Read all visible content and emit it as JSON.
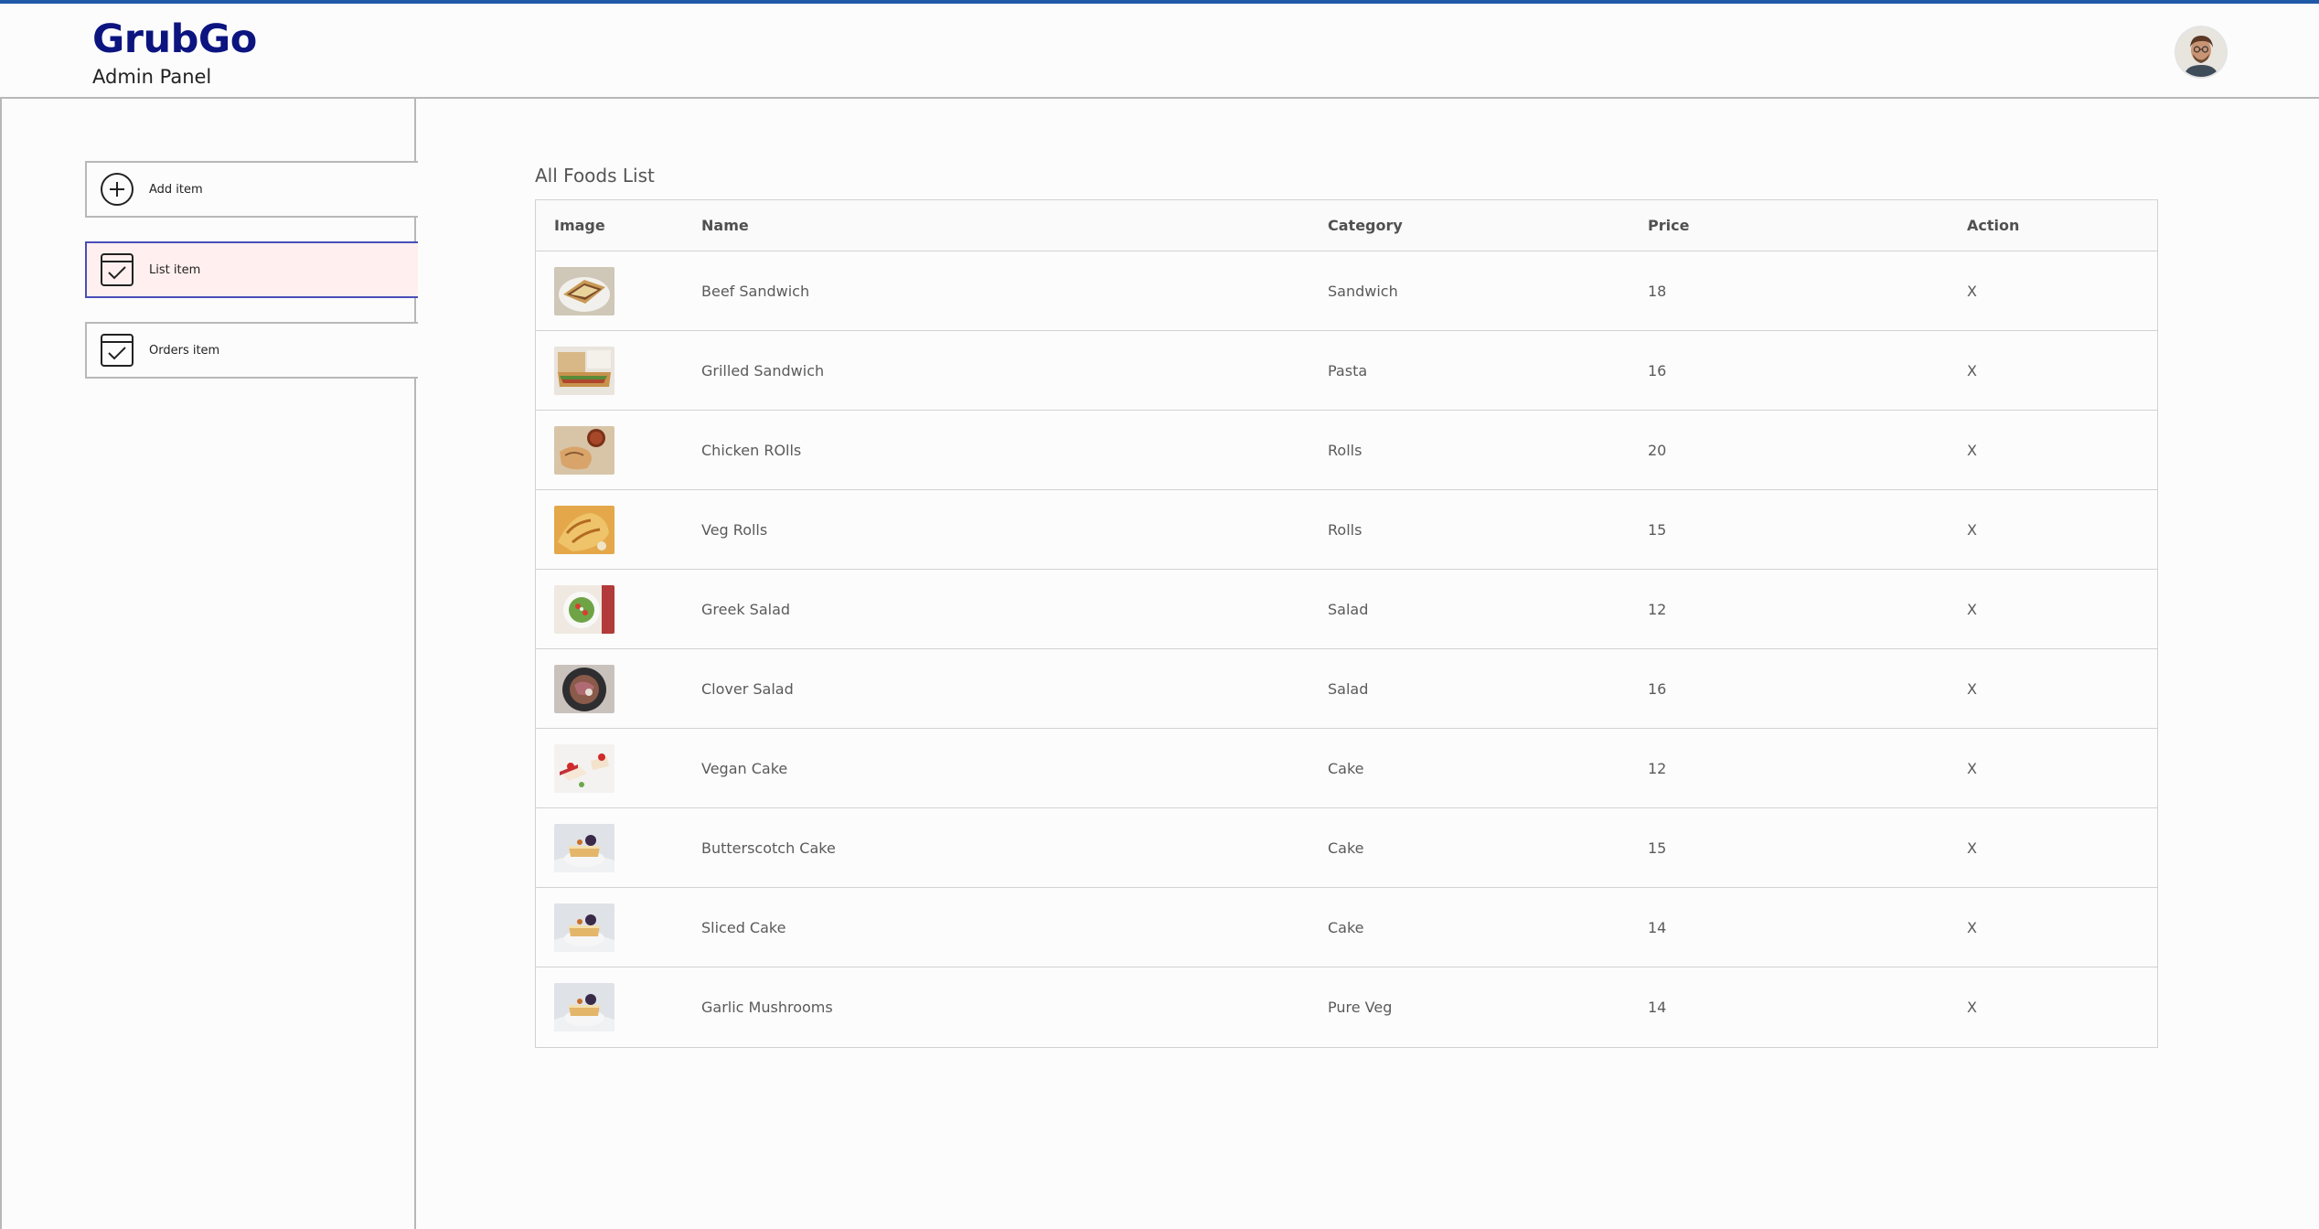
{
  "brand": {
    "title": "GrubGo",
    "subtitle": "Admin Panel",
    "accent_color": "#0c1480",
    "topline_color": "#1f59a8"
  },
  "header": {
    "avatar_icon": "profile-avatar"
  },
  "sidebar": {
    "items": [
      {
        "label": "Add item",
        "icon": "plus-circle-icon",
        "active": false
      },
      {
        "label": "List item",
        "icon": "checkbox-calendar-icon",
        "active": true
      },
      {
        "label": "Orders item",
        "icon": "checkbox-calendar-icon",
        "active": false
      }
    ],
    "active_bg": "#fff0ef",
    "active_border": "#4a4fb8"
  },
  "main": {
    "title": "All Foods List",
    "columns": [
      "Image",
      "Name",
      "Category",
      "Price",
      "Action"
    ],
    "rows": [
      {
        "name": "Beef Sandwich",
        "category": "Sandwich",
        "price": "18",
        "action": "X",
        "thumb": "sandwich"
      },
      {
        "name": "Grilled Sandwich",
        "category": "Pasta",
        "price": "16",
        "action": "X",
        "thumb": "grilled"
      },
      {
        "name": "Chicken ROlls",
        "category": "Rolls",
        "price": "20",
        "action": "X",
        "thumb": "rolls"
      },
      {
        "name": "Veg Rolls",
        "category": "Rolls",
        "price": "15",
        "action": "X",
        "thumb": "vegrolls"
      },
      {
        "name": "Greek Salad",
        "category": "Salad",
        "price": "12",
        "action": "X",
        "thumb": "greek"
      },
      {
        "name": "Clover Salad",
        "category": "Salad",
        "price": "16",
        "action": "X",
        "thumb": "clover"
      },
      {
        "name": "Vegan Cake",
        "category": "Cake",
        "price": "12",
        "action": "X",
        "thumb": "vegancake"
      },
      {
        "name": "Butterscotch Cake",
        "category": "Cake",
        "price": "15",
        "action": "X",
        "thumb": "cake"
      },
      {
        "name": "Sliced Cake",
        "category": "Cake",
        "price": "14",
        "action": "X",
        "thumb": "cake"
      },
      {
        "name": "Garlic Mushrooms",
        "category": "Pure Veg",
        "price": "14",
        "action": "X",
        "thumb": "cake"
      }
    ]
  }
}
